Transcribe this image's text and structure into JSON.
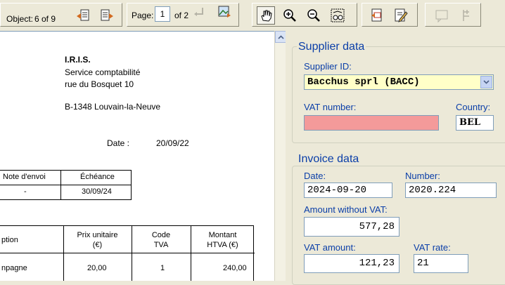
{
  "toolbar": {
    "object_label": "Object:",
    "object_value": "6 of 9",
    "page_label": "Page:",
    "page_value": "1",
    "page_of": "of 2"
  },
  "document": {
    "company": "I.R.I.S.",
    "department": "Service comptabilité",
    "street": "rue du Bosquet 10",
    "city": "B-1348 Louvain-la-Neuve",
    "date_label": "Date :",
    "date_value": "20/09/22",
    "table1": {
      "headers": [
        "Note d'envoi",
        "Échéance"
      ],
      "row": [
        "-",
        "30/09/24"
      ]
    },
    "table2": {
      "headers": [
        "ption",
        "Prix unitaire\n(€)",
        "Code\nTVA",
        "Montant\nHTVA (€)"
      ],
      "row": [
        "npagne",
        "20,00",
        "1",
        "240,00"
      ]
    }
  },
  "supplier": {
    "title": "Supplier data",
    "id_label": "Supplier ID:",
    "id_value": "Bacchus sprl (BACC)",
    "vat_label": "VAT number:",
    "vat_value": "",
    "country_label": "Country:",
    "country_value": "BEL"
  },
  "invoice": {
    "title": "Invoice data",
    "date_label": "Date:",
    "date_value": "2024-09-20",
    "number_label": "Number:",
    "number_value": "2020.224",
    "amount_label": "Amount without VAT:",
    "amount_value": "577,28",
    "vat_amount_label": "VAT amount:",
    "vat_amount_value": "121,23",
    "vat_rate_label": "VAT rate:",
    "vat_rate_value": "21"
  },
  "colors": {
    "label_blue": "#0a3ea8",
    "invalid_field": "#f49a9a",
    "selected_field": "#ffffc8"
  }
}
